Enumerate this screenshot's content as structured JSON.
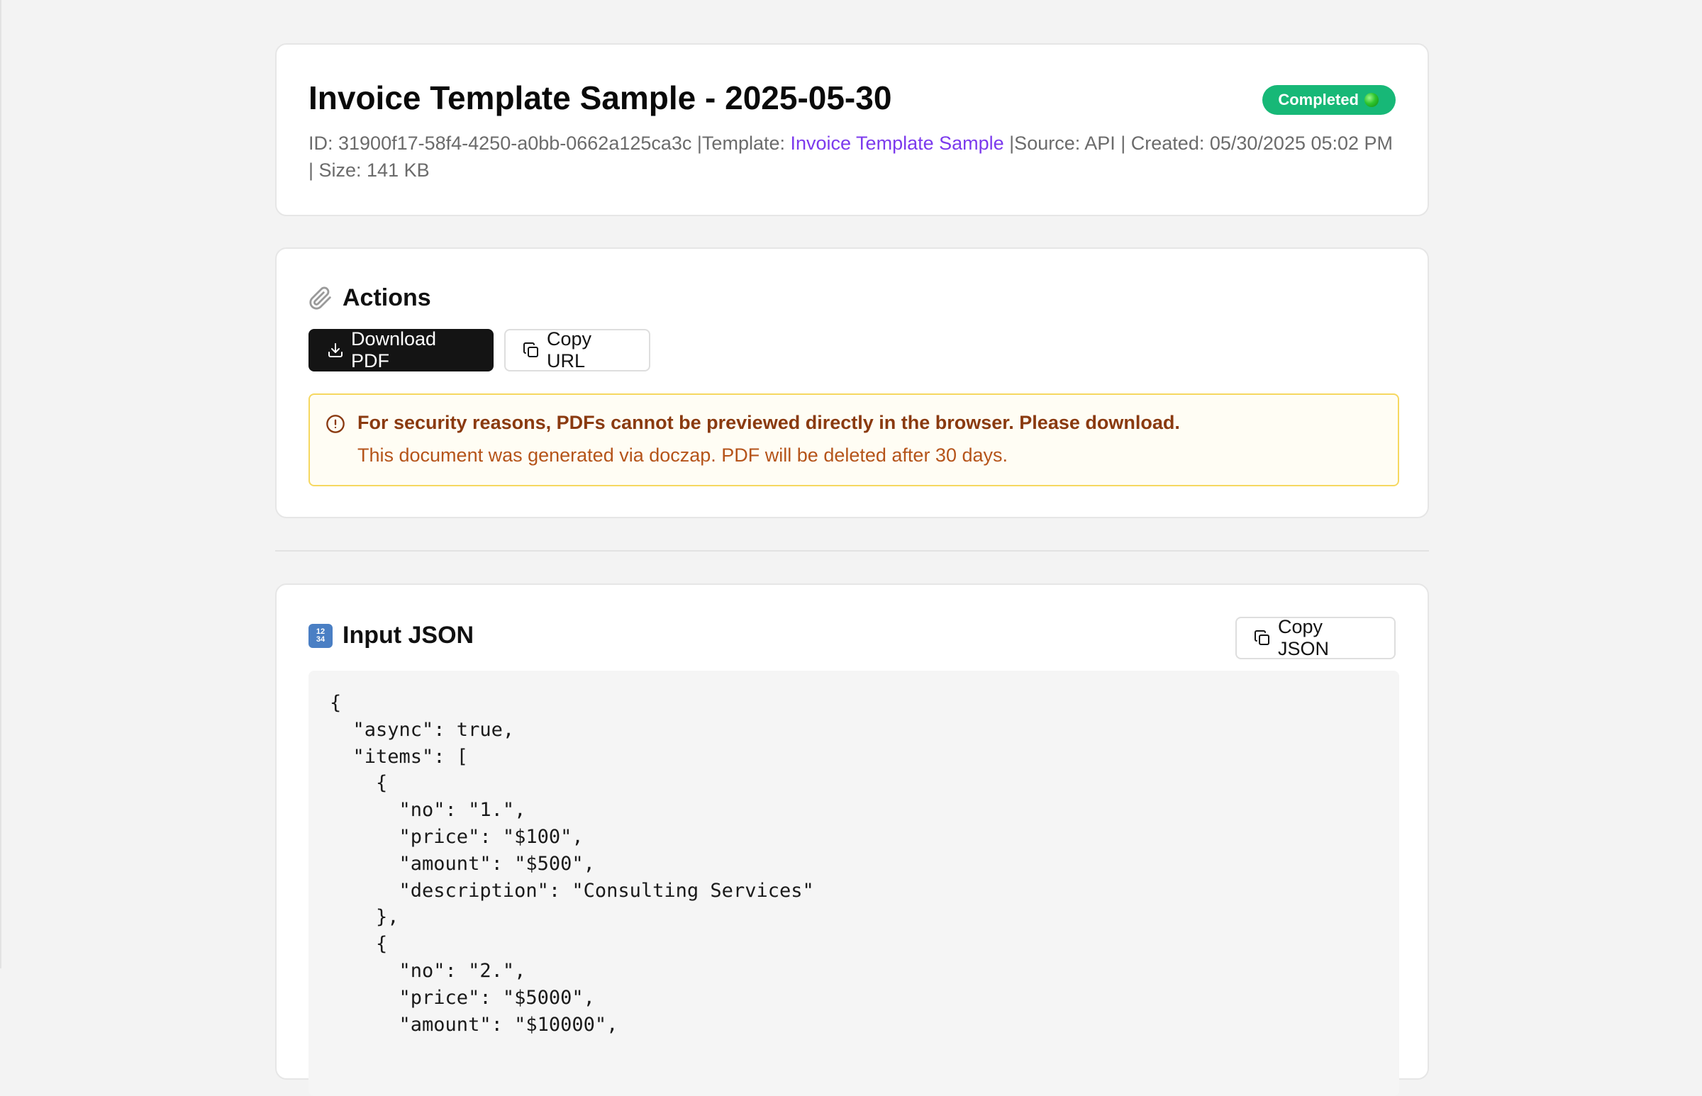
{
  "header": {
    "title": "Invoice Template Sample - 2025-05-30",
    "status": "Completed",
    "meta_prefix": "ID: 31900f17-58f4-4250-a0bb-0662a125ca3c |Template: ",
    "template_link": "Invoice Template Sample",
    "meta_suffix": " |Source: API | Created: 05/30/2025 05:02 PM | Size: 141 KB"
  },
  "actions": {
    "title": "Actions",
    "download_label": "Download PDF",
    "copy_url_label": "Copy URL",
    "alert_title": "For security reasons, PDFs cannot be previewed directly in the browser. Please download.",
    "alert_text": "This document was generated via doczap. PDF will be deleted after 30 days."
  },
  "input_json": {
    "title": "Input JSON",
    "copy_label": "Copy JSON",
    "code": "{\n  \"async\": true,\n  \"items\": [\n    {\n      \"no\": \"1.\",\n      \"price\": \"$100\",\n      \"amount\": \"$500\",\n      \"description\": \"Consulting Services\"\n    },\n    {\n      \"no\": \"2.\",\n      \"price\": \"$5000\",\n      \"amount\": \"$10000\","
  },
  "colors": {
    "status_green": "#17b877",
    "link_purple": "#7c3aed",
    "alert_border": "#f6d860",
    "alert_title": "#8a3a10",
    "alert_text": "#b5541a",
    "primary_button": "#141414"
  },
  "icons": {
    "status": "green-circle-icon",
    "actions": "paperclip-icon",
    "download": "download-icon",
    "copy": "copy-icon",
    "alert": "alert-circle-icon",
    "json": "input-numbers-icon"
  }
}
